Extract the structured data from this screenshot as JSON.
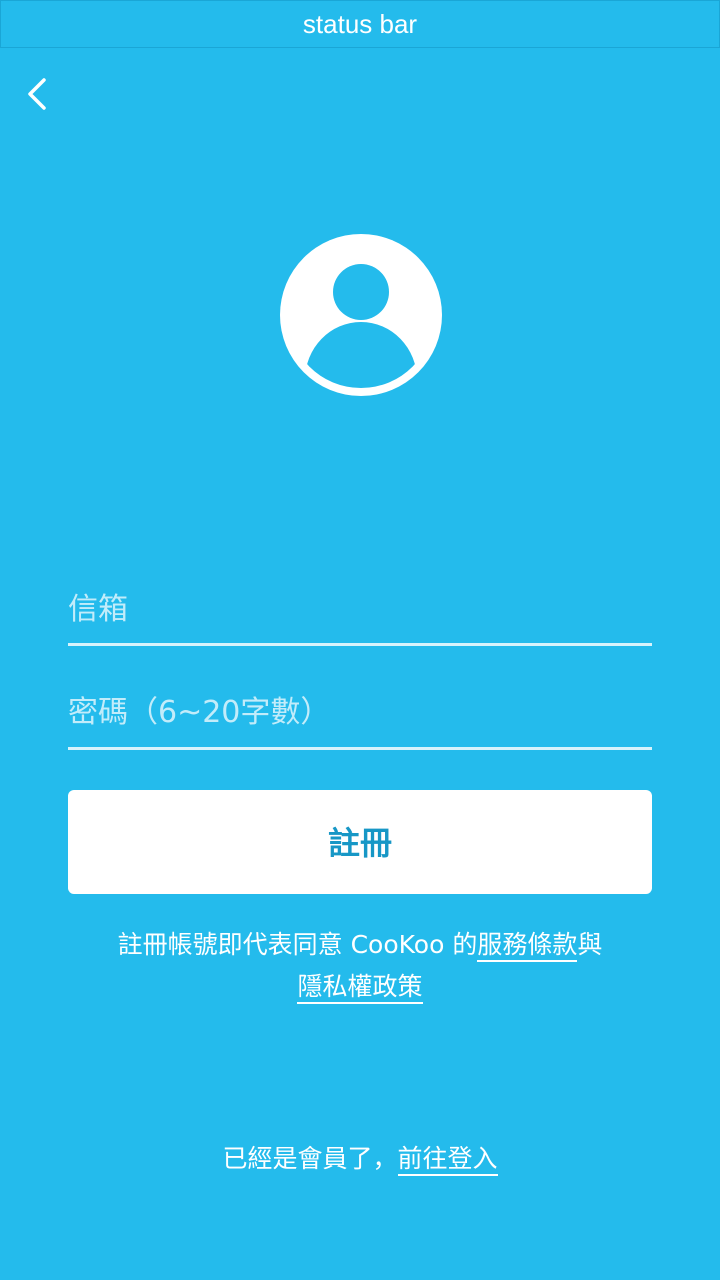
{
  "status_bar": {
    "label": "status bar"
  },
  "nav": {
    "back_icon": "chevron-left-icon"
  },
  "avatar": {
    "icon": "user-avatar-icon"
  },
  "form": {
    "email_placeholder": "信箱",
    "password_placeholder": "密碼（6~20字數）",
    "email_value": "",
    "password_value": "",
    "register_label": "註冊"
  },
  "terms": {
    "prefix": "註冊帳號即代表同意 CooKoo 的",
    "service_link": "服務條款",
    "conjunction": "與",
    "privacy_link": "隱私權政策"
  },
  "login": {
    "prompt": "已經是會員了，",
    "link": "前往登入"
  },
  "colors": {
    "background": "#24BBEC",
    "button_text": "#1797C6",
    "text": "#FFFFFF"
  }
}
